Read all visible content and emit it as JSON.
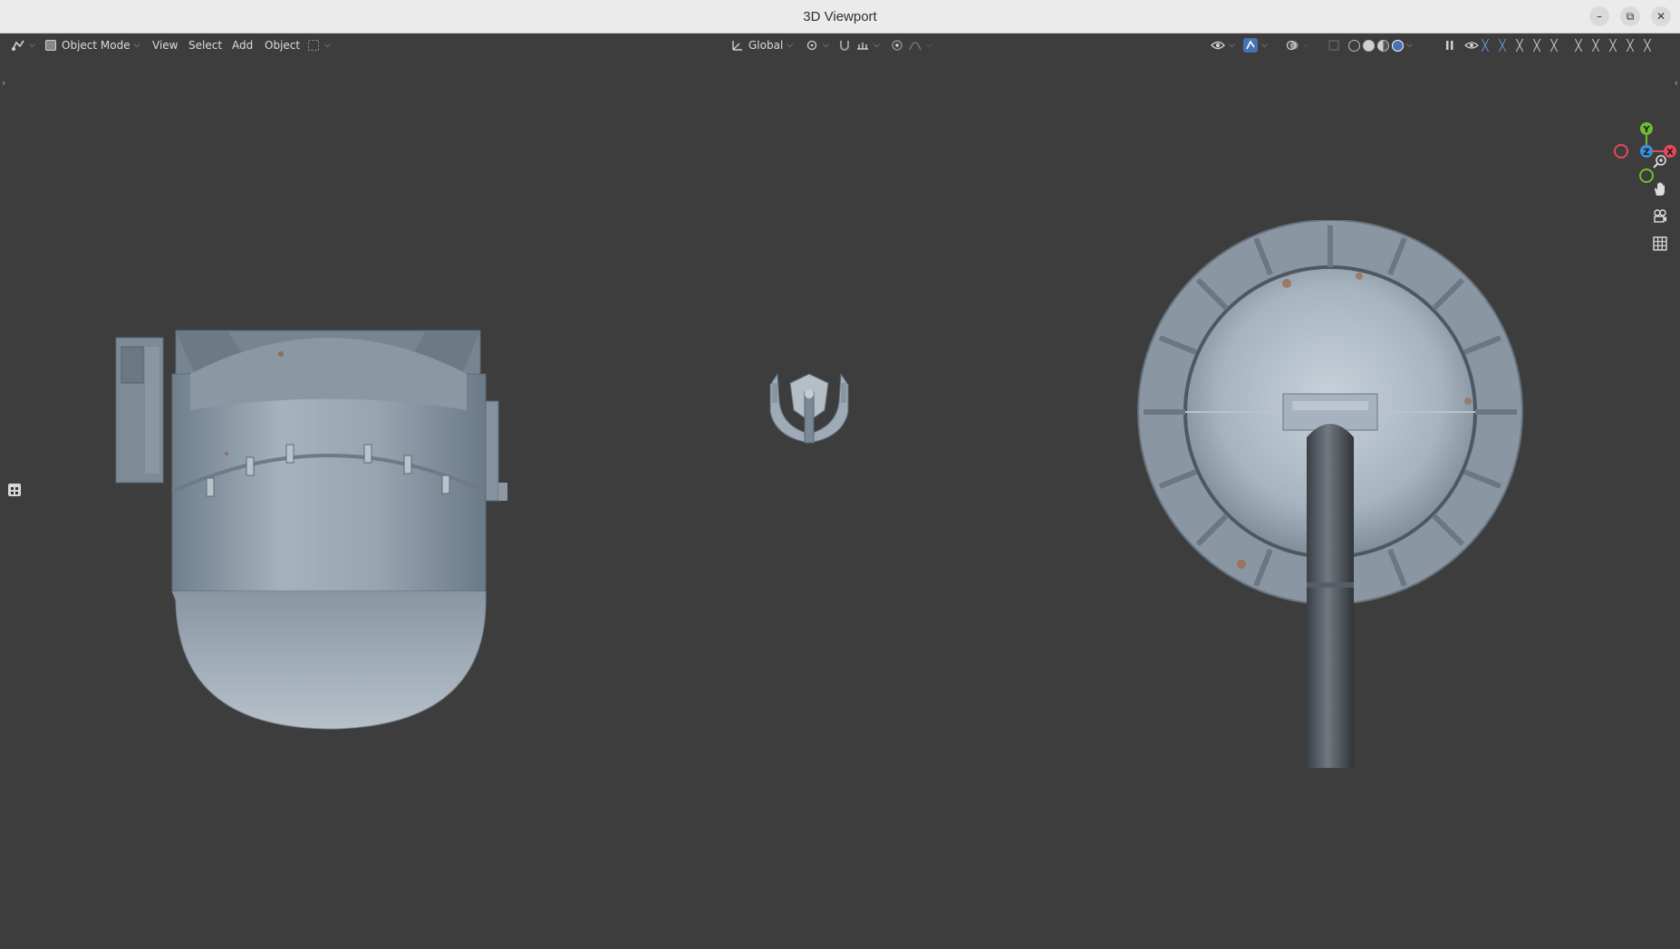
{
  "window": {
    "title": "3D Viewport",
    "controls": [
      "minimize",
      "maximize",
      "close"
    ]
  },
  "header": {
    "editor_type_icon": "editor-type-icon",
    "mode": {
      "label": "Object Mode",
      "icon": "object-mode-icon"
    },
    "menus": [
      "View",
      "Select",
      "Add",
      "Object"
    ],
    "select_box_icon": "select-box-icon",
    "transform_orientation": {
      "label": "Global",
      "icon": "orientation-icon"
    },
    "pivot_icon": "pivot-point-icon",
    "snap_icon": "snap-icon",
    "snap_increment_icon": "snap-increment-icon",
    "proportional_icon": "proportional-edit-icon",
    "falloff_icon": "falloff-icon"
  },
  "right_header": {
    "visibility_icon": "object-visibility-icon",
    "gizmo_toggle_icon": "gizmo-toggle-icon",
    "overlay_icon": "overlay-icon",
    "xray_icon": "xray-icon",
    "shading_modes": [
      "wireframe",
      "solid",
      "material-preview",
      "rendered"
    ],
    "active_shading": "rendered",
    "pause_icon": "pause-icon",
    "eye_icon": "eye-icon",
    "accent": "#4772b3"
  },
  "navigation_gizmo": {
    "axes": [
      {
        "name": "Y",
        "color": "#6fbd2f"
      },
      {
        "name": "X",
        "color": "#e44a5a"
      },
      {
        "name": "Z",
        "color": "#3c8fd8"
      }
    ]
  },
  "nav_buttons": [
    "zoom-icon",
    "pan-hand-icon",
    "camera-view-icon",
    "ortho-grid-icon"
  ],
  "scene": {
    "background": "#3d3d3d",
    "objects": [
      "cylindrical-tank-model",
      "small-turret-model",
      "round-turret-model"
    ]
  }
}
